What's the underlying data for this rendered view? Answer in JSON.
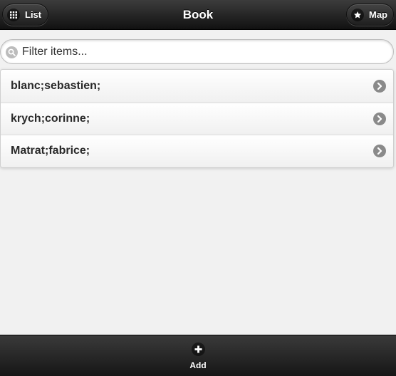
{
  "header": {
    "title": "Book",
    "left_button": {
      "label": "List",
      "icon": "grid-icon"
    },
    "right_button": {
      "label": "Map",
      "icon": "star-icon"
    }
  },
  "search": {
    "placeholder": "Filter items...",
    "value": "",
    "icon": "search-icon"
  },
  "list": {
    "items": [
      {
        "label": "blanc;sebastien;"
      },
      {
        "label": "krych;corinne;"
      },
      {
        "label": "Matrat;fabrice;"
      }
    ],
    "item_icon": "chevron-right-icon"
  },
  "footer": {
    "add_button": {
      "label": "Add",
      "icon": "plus-icon"
    }
  },
  "colors": {
    "bar": "#1e1e1e",
    "background": "#f1f1f1",
    "chevron": "#8a8a8a"
  }
}
